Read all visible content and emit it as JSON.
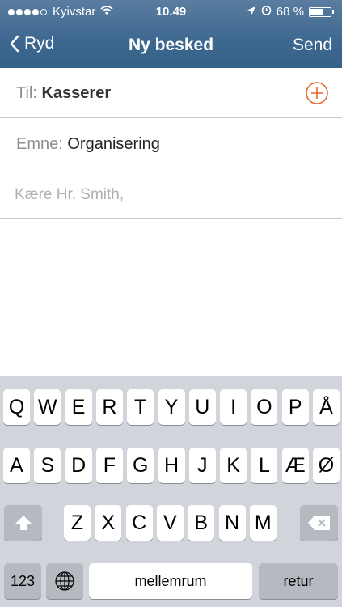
{
  "status": {
    "carrier": "Kyivstar",
    "time": "10.49",
    "battery": "68 %",
    "battery_level": 0.68,
    "signal_bars_filled": 4,
    "signal_bars_total": 5
  },
  "nav": {
    "back_label": "Ryd",
    "title": "Ny besked",
    "send_label": "Send"
  },
  "form": {
    "to_label": "Til:",
    "to_value": "Kasserer",
    "subject_label": "Emne:",
    "subject_value": "Organisering",
    "body_placeholder": "Kære Hr. Smith,"
  },
  "keyboard": {
    "row1": [
      "Q",
      "W",
      "E",
      "R",
      "T",
      "Y",
      "U",
      "I",
      "O",
      "P",
      "Å"
    ],
    "row2": [
      "A",
      "S",
      "D",
      "F",
      "G",
      "H",
      "J",
      "K",
      "L",
      "Æ",
      "Ø"
    ],
    "row3": [
      "Z",
      "X",
      "C",
      "V",
      "B",
      "N",
      "M"
    ],
    "numbers_label": "123",
    "space_label": "mellemrum",
    "return_label": "retur"
  },
  "colors": {
    "header": "#3d6890",
    "accent": "#e8662a",
    "keyboard_bg": "#d1d5db"
  }
}
